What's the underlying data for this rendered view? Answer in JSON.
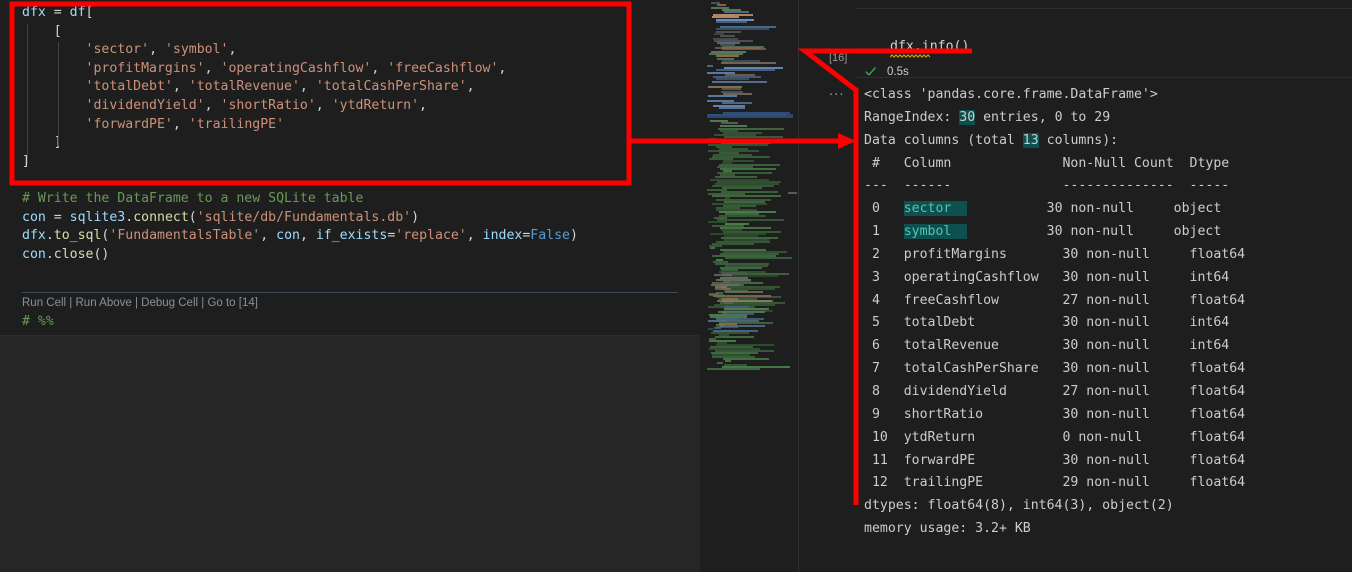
{
  "editor": {
    "code_lines": [
      [
        {
          "t": "dfx ",
          "c": "tk-var"
        },
        {
          "t": "= ",
          "c": "tk-op"
        },
        {
          "t": "df",
          "c": "tk-var"
        },
        {
          "t": "[",
          "c": "tk-plain"
        }
      ],
      [
        {
          "t": "    [",
          "c": "tk-plain"
        }
      ],
      [
        {
          "t": "        ",
          "c": "tk-plain"
        },
        {
          "t": "'sector'",
          "c": "tk-str"
        },
        {
          "t": ", ",
          "c": "tk-plain"
        },
        {
          "t": "'symbol'",
          "c": "tk-str"
        },
        {
          "t": ",",
          "c": "tk-plain"
        }
      ],
      [
        {
          "t": "        ",
          "c": "tk-plain"
        },
        {
          "t": "'profitMargins'",
          "c": "tk-str"
        },
        {
          "t": ", ",
          "c": "tk-plain"
        },
        {
          "t": "'operatingCashflow'",
          "c": "tk-str"
        },
        {
          "t": ", ",
          "c": "tk-plain"
        },
        {
          "t": "'freeCashflow'",
          "c": "tk-str"
        },
        {
          "t": ",",
          "c": "tk-plain"
        }
      ],
      [
        {
          "t": "        ",
          "c": "tk-plain"
        },
        {
          "t": "'totalDebt'",
          "c": "tk-str"
        },
        {
          "t": ", ",
          "c": "tk-plain"
        },
        {
          "t": "'totalRevenue'",
          "c": "tk-str"
        },
        {
          "t": ", ",
          "c": "tk-plain"
        },
        {
          "t": "'totalCashPerShare'",
          "c": "tk-str"
        },
        {
          "t": ",",
          "c": "tk-plain"
        }
      ],
      [
        {
          "t": "        ",
          "c": "tk-plain"
        },
        {
          "t": "'dividendYield'",
          "c": "tk-str"
        },
        {
          "t": ", ",
          "c": "tk-plain"
        },
        {
          "t": "'shortRatio'",
          "c": "tk-str"
        },
        {
          "t": ", ",
          "c": "tk-plain"
        },
        {
          "t": "'ytdReturn'",
          "c": "tk-str"
        },
        {
          "t": ",",
          "c": "tk-plain"
        }
      ],
      [
        {
          "t": "        ",
          "c": "tk-plain"
        },
        {
          "t": "'forwardPE'",
          "c": "tk-str"
        },
        {
          "t": ", ",
          "c": "tk-plain"
        },
        {
          "t": "'trailingPE'",
          "c": "tk-str"
        }
      ],
      [
        {
          "t": "    ]",
          "c": "tk-plain"
        }
      ],
      [
        {
          "t": "]",
          "c": "tk-plain"
        }
      ],
      [],
      [
        {
          "t": "# Write the DataFrame to a new SQLite table",
          "c": "tk-com"
        }
      ],
      [
        {
          "t": "con ",
          "c": "tk-var"
        },
        {
          "t": "= ",
          "c": "tk-op"
        },
        {
          "t": "sqlite3",
          "c": "tk-var"
        },
        {
          "t": ".",
          "c": "tk-plain"
        },
        {
          "t": "connect",
          "c": "tk-fn"
        },
        {
          "t": "(",
          "c": "tk-plain"
        },
        {
          "t": "'sqlite/db/Fundamentals.db'",
          "c": "tk-str"
        },
        {
          "t": ")",
          "c": "tk-plain"
        }
      ],
      [
        {
          "t": "dfx",
          "c": "tk-var"
        },
        {
          "t": ".",
          "c": "tk-plain"
        },
        {
          "t": "to_sql",
          "c": "tk-fn"
        },
        {
          "t": "(",
          "c": "tk-plain"
        },
        {
          "t": "'FundamentalsTable'",
          "c": "tk-str"
        },
        {
          "t": ", ",
          "c": "tk-plain"
        },
        {
          "t": "con",
          "c": "tk-var"
        },
        {
          "t": ", ",
          "c": "tk-plain"
        },
        {
          "t": "if_exists",
          "c": "tk-var"
        },
        {
          "t": "=",
          "c": "tk-op"
        },
        {
          "t": "'replace'",
          "c": "tk-str"
        },
        {
          "t": ", ",
          "c": "tk-plain"
        },
        {
          "t": "index",
          "c": "tk-var"
        },
        {
          "t": "=",
          "c": "tk-op"
        },
        {
          "t": "False",
          "c": "tk-blue"
        },
        {
          "t": ")",
          "c": "tk-plain"
        }
      ],
      [
        {
          "t": "con",
          "c": "tk-var"
        },
        {
          "t": ".",
          "c": "tk-plain"
        },
        {
          "t": "close",
          "c": "tk-fn"
        },
        {
          "t": "()",
          "c": "tk-plain"
        }
      ]
    ],
    "codelens": [
      "Run Cell",
      "Run Above",
      "Debug Cell",
      "Go to [14]"
    ],
    "codelens_separator": " | ",
    "next_cell_marker": "# %%"
  },
  "gutter": {
    "execution_count": "[16]",
    "collapsed_dots": "..."
  },
  "output_cell": {
    "source": "dfx.info()",
    "status_icon": "check-icon",
    "runtime": "0.5s",
    "lines": [
      [
        {
          "t": "<class 'pandas.core.frame.DataFrame'>"
        }
      ],
      [
        {
          "t": "RangeIndex: "
        },
        {
          "t": "30",
          "h": "hl2"
        },
        {
          "t": " entries, 0 to 29"
        }
      ],
      [
        {
          "t": "Data columns (total "
        },
        {
          "t": "13",
          "h": "hl2"
        },
        {
          "t": " columns):"
        }
      ],
      [
        {
          "t": " #   Column              Non-Null Count  Dtype  "
        }
      ],
      [
        {
          "t": "---  ------              --------------  -----  "
        }
      ],
      [
        {
          "t": " 0   "
        },
        {
          "t": "sector  ",
          "h": "hl"
        },
        {
          "t": "          30 non-null     object "
        }
      ],
      [
        {
          "t": " 1   "
        },
        {
          "t": "symbol  ",
          "h": "hl"
        },
        {
          "t": "          30 non-null     object "
        }
      ],
      [
        {
          "t": " 2   profitMargins       30 non-null     float64"
        }
      ],
      [
        {
          "t": " 3   operatingCashflow   30 non-null     int64  "
        }
      ],
      [
        {
          "t": " 4   freeCashflow        27 non-null     float64"
        }
      ],
      [
        {
          "t": " 5   totalDebt           30 non-null     int64  "
        }
      ],
      [
        {
          "t": " 6   totalRevenue        30 non-null     int64  "
        }
      ],
      [
        {
          "t": " 7   totalCashPerShare   30 non-null     float64"
        }
      ],
      [
        {
          "t": " 8   dividendYield       27 non-null     float64"
        }
      ],
      [
        {
          "t": " 9   shortRatio          30 non-null     float64"
        }
      ],
      [
        {
          "t": " 10  ytdReturn           0 non-null      float64"
        }
      ],
      [
        {
          "t": " 11  forwardPE           30 non-null     float64"
        }
      ],
      [
        {
          "t": " 12  trailingPE          29 non-null     float64"
        }
      ],
      [
        {
          "t": "dtypes: float64(8), int64(3), object(2)"
        }
      ],
      [
        {
          "t": "memory usage: 3.2+ KB"
        }
      ]
    ]
  },
  "annotations": {
    "highlight_color": "#ff0000",
    "box_label": "column-selection-box",
    "arrow_labels": [
      "arrow-to-info-call",
      "arrow-to-output-columns"
    ]
  }
}
